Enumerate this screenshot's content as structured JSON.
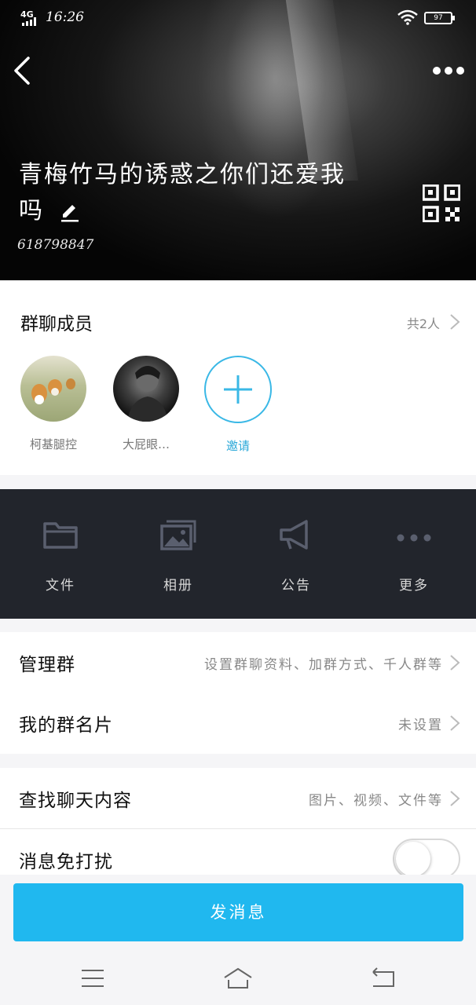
{
  "status_bar": {
    "network": "4G",
    "time": "16:26",
    "battery": "97"
  },
  "header": {
    "group_name": "青梅竹马的诱惑之你们还爱我吗",
    "group_id": "618798847"
  },
  "members": {
    "title": "群聊成员",
    "count": "共2人",
    "list": [
      {
        "name": "柯基腿控"
      },
      {
        "name": "大屁眼…"
      }
    ],
    "invite_label": "邀请"
  },
  "tools": [
    {
      "label": "文件",
      "icon": "folder-icon"
    },
    {
      "label": "相册",
      "icon": "album-icon"
    },
    {
      "label": "公告",
      "icon": "megaphone-icon"
    },
    {
      "label": "更多",
      "icon": "more-dots-icon"
    }
  ],
  "rows": {
    "manage": {
      "title": "管理群",
      "value": "设置群聊资料、加群方式、千人群等"
    },
    "card": {
      "title": "我的群名片",
      "value": "未设置"
    },
    "search": {
      "title": "查找聊天内容",
      "value": "图片、视频、文件等"
    },
    "mute": {
      "title": "消息免打扰",
      "enabled": false
    }
  },
  "send_button": "发消息",
  "colors": {
    "accent": "#20b8ef",
    "tools_bg": "#22252c",
    "invite": "#3ab8e6"
  }
}
